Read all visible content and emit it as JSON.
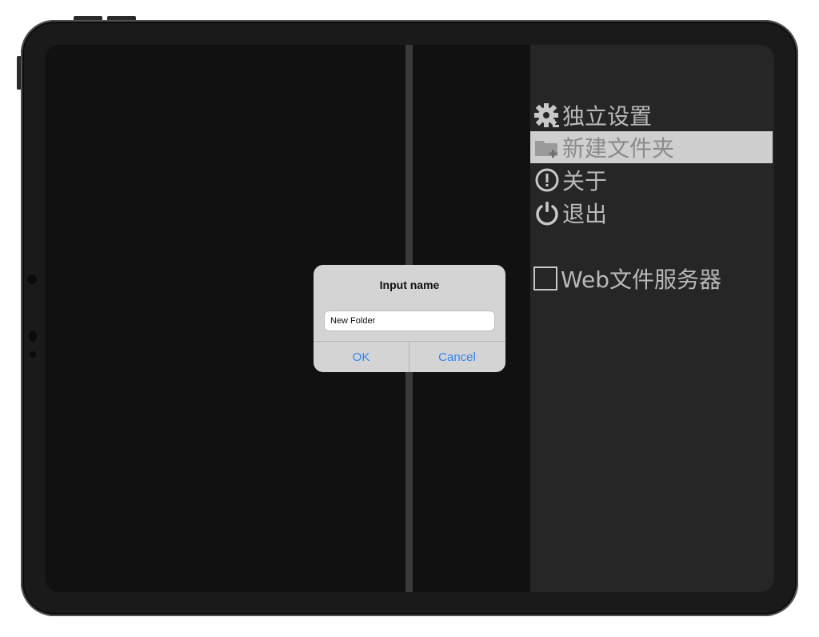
{
  "menu": {
    "items": [
      {
        "id": "settings",
        "label": "独立设置",
        "icon": "gear-icon"
      },
      {
        "id": "new_folder",
        "label": "新建文件夹",
        "icon": "folder-add-icon",
        "selected": true
      },
      {
        "id": "about",
        "label": "关于",
        "icon": "info-circle-icon"
      },
      {
        "id": "exit",
        "label": "退出",
        "icon": "power-icon"
      }
    ],
    "web_server": {
      "label": "Web文件服务器",
      "checked": false
    }
  },
  "dialog": {
    "title": "Input name",
    "input_value": "New Folder",
    "ok_label": "OK",
    "cancel_label": "Cancel"
  },
  "colors": {
    "menu_bg": "#262626",
    "menu_text": "#b9b9b9",
    "selected_bg": "#cfcfcf",
    "dialog_bg": "#d4d4d4",
    "button_blue": "#2f86f6"
  }
}
